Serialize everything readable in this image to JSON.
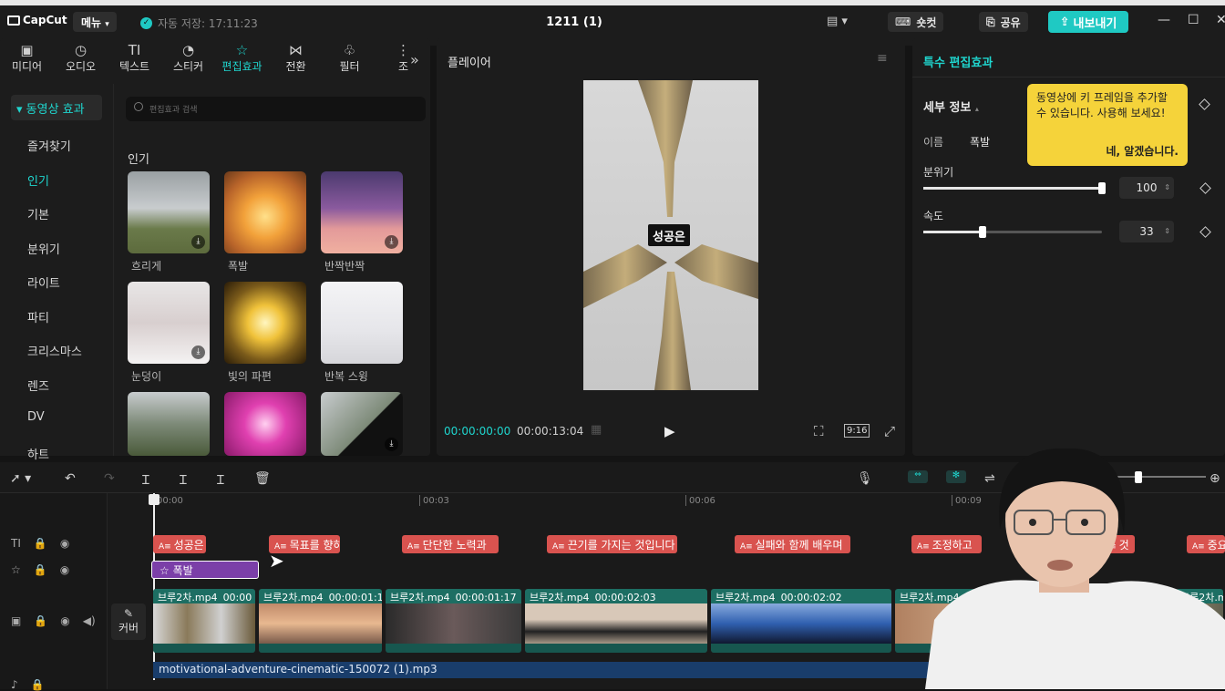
{
  "app": {
    "logo": "CapCut",
    "menu_label": "메뉴",
    "autosave": "자동 저장: 17:11:23",
    "project_title": "1211 (1)",
    "shortcut_label": "숏컷",
    "share_label": "공유",
    "export_label": "내보내기"
  },
  "colors": {
    "accent": "#1fd6cf",
    "text_clip": "#d9534f",
    "effect_clip": "#7b3fa8",
    "video_clip": "#1d6e63",
    "audio_clip": "#193d6b",
    "tooltip": "#f5d33a"
  },
  "media_tabs": [
    {
      "label": "미디어",
      "icon": "media-icon",
      "glyph": "▣"
    },
    {
      "label": "오디오",
      "icon": "audio-icon",
      "glyph": "◷"
    },
    {
      "label": "텍스트",
      "icon": "text-icon",
      "glyph": "TI"
    },
    {
      "label": "스티커",
      "icon": "sticker-icon",
      "glyph": "◔"
    },
    {
      "label": "편집효과",
      "icon": "effects-icon",
      "glyph": "☆",
      "active": true
    },
    {
      "label": "전환",
      "icon": "transition-icon",
      "glyph": "⋈"
    },
    {
      "label": "필터",
      "icon": "filter-icon",
      "glyph": "♧"
    },
    {
      "label": "조",
      "icon": "adjust-icon",
      "glyph": "⋮"
    }
  ],
  "effects_panel": {
    "category_header": "동영상 효과",
    "categories": [
      "즐겨찾기",
      "인기",
      "기본",
      "분위기",
      "라이트",
      "파티",
      "크리스마스",
      "렌즈",
      "DV",
      "하트"
    ],
    "selected_category": "인기",
    "search_placeholder": "편집효과 검색",
    "section_title": "인기",
    "items": [
      {
        "label": "흐리게",
        "download": true
      },
      {
        "label": "폭발",
        "download": false
      },
      {
        "label": "반짝반짝",
        "download": true
      },
      {
        "label": "눈덩이",
        "download": true
      },
      {
        "label": "빛의 파편",
        "download": false
      },
      {
        "label": "반복 스윙",
        "download": false
      },
      {
        "label": "",
        "download": false
      },
      {
        "label": "",
        "download": false
      },
      {
        "label": "",
        "download": true
      }
    ]
  },
  "player": {
    "title": "플레이어",
    "caption": "성공은",
    "current_time": "00:00:00:00",
    "total_time": "00:00:13:04",
    "ratio": "9:16"
  },
  "inspector": {
    "title": "특수 편집효과",
    "detail_label": "세부 정보",
    "name_label": "이름",
    "name_value": "폭발",
    "tooltip_text": "동영상에 키 프레임을 추가할 수 있습니다. 사용해 보세요!",
    "tooltip_button": "네, 알겠습니다.",
    "params": [
      {
        "label": "분위기",
        "value": "100",
        "level": 100
      },
      {
        "label": "속도",
        "value": "33",
        "level": 33
      }
    ]
  },
  "timeline": {
    "ruler": [
      "00:00",
      "00:03",
      "00:06",
      "00:09"
    ],
    "cover_label": "커버",
    "text_clips": [
      "성공은",
      "목표를 향하",
      "단단한 노력과",
      "끈기를 가지는 것입니다",
      "실패와 함께 배우며",
      "조정하고",
      "것",
      "중요"
    ],
    "effect_clip": "폭발",
    "video_clips": [
      {
        "name": "브루2차.mp4",
        "duration": "00:00"
      },
      {
        "name": "브루2차.mp4",
        "duration": "00:00:01:13"
      },
      {
        "name": "브루2차.mp4",
        "duration": "00:00:01:17"
      },
      {
        "name": "브루2차.mp4",
        "duration": "00:00:02:03"
      },
      {
        "name": "브루2차.mp4",
        "duration": "00:00:02:02"
      },
      {
        "name": "브루2차.mp4",
        "duration": ""
      },
      {
        "name": "브루2차.mp4",
        "duration": ""
      }
    ],
    "audio_clip": "motivational-adventure-cinematic-150072 (1).mp3"
  }
}
